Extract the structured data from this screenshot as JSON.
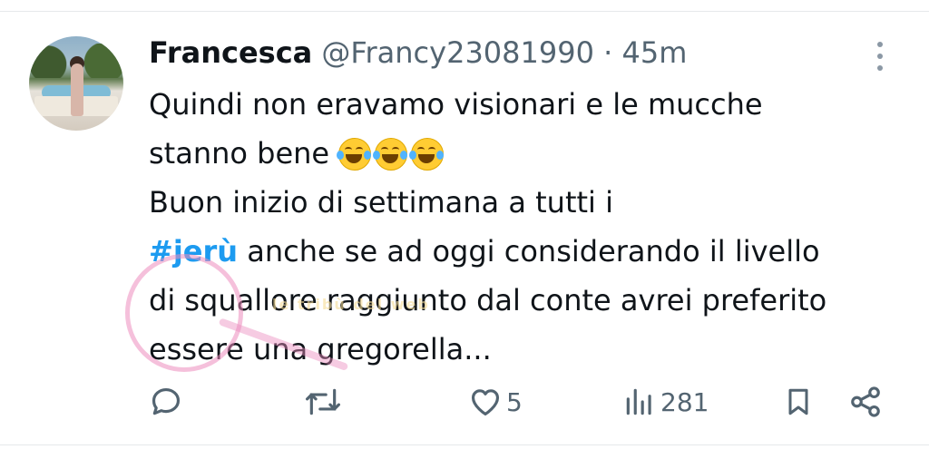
{
  "tweet": {
    "author_name": "Francesca",
    "handle": "@Francy23081990",
    "separator": "·",
    "time": "45m",
    "text_line1": "Quindi non eravamo visionari e le mucche",
    "text_line2": "stanno bene",
    "text_line3": "Buon inizio di settimana a tutti i",
    "hashtag": "#jerù",
    "text_line4_rest": " anche se ad oggi considerando il livello",
    "text_line5": "di squallore raggiunto dal conte avrei preferito",
    "text_line6": "essere una gregorella..."
  },
  "actions": {
    "likes": "5",
    "views": "281"
  },
  "watermark": {
    "text": "le tribù del web"
  },
  "colors": {
    "hashtag": "#1d9bf0",
    "secondary_text": "#536471",
    "icons": "#536471"
  },
  "icons": {
    "reply": "reply-icon",
    "retweet": "retweet-icon",
    "like": "heart-icon",
    "views": "views-icon",
    "bookmark": "bookmark-icon",
    "share": "share-icon",
    "more": "more-vertical-icon"
  }
}
